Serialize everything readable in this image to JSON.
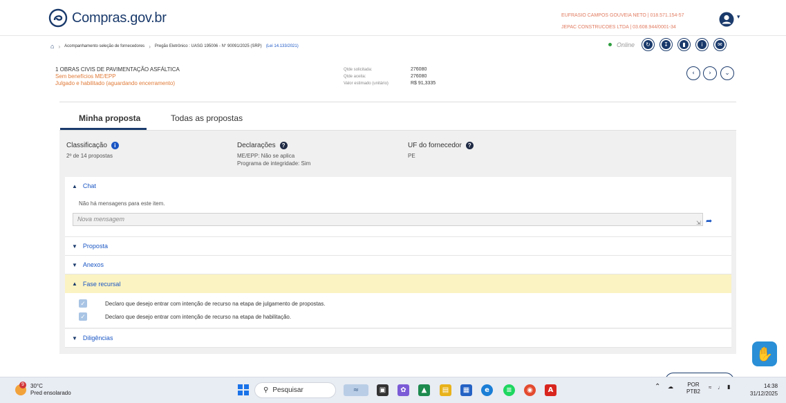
{
  "header": {
    "brand": "Compras.gov.br",
    "user_line1": "EUFRASIO CAMPOS GOUVEIA NETO | 018.571.154-57",
    "user_line2": "JEPAC CONSTRUCOES LTDA | 03.608.944/0001-34"
  },
  "breadcrumb": {
    "item1": "Acompanhamento seleção de fornecedores",
    "item2": "Pregão Eletrônico : UASG 195006 - N° 90091/2025 (SRP)",
    "item2_link": "(Lei 14.133/2021)"
  },
  "status": {
    "online": "Online"
  },
  "item": {
    "title": "1  OBRAS CIVIS DE PAVIMENTAÇÃO ASFÁLTICA",
    "benefit": "Sem benefícios ME/EPP",
    "situation": "Julgado e habilitado (aguardando encerramento)",
    "qty_requested_label": "Qtde solicitada:",
    "qty_accepted_label": "Qtde aceita:",
    "estimated_value_label": "Valor estimado (unitário)",
    "qty_requested": "276080",
    "qty_accepted": "276080",
    "estimated_value": "R$ 91,3335"
  },
  "tabs": {
    "my_proposal": "Minha proposta",
    "all_proposals": "Todas as propostas"
  },
  "classification": {
    "label": "Classificação",
    "value": "2º de 14 propostas"
  },
  "declarations": {
    "label": "Declarações",
    "me_epp": "ME/EPP: Não se aplica",
    "integrity": "Programa de integridade: Sim"
  },
  "uf": {
    "label": "UF do fornecedor",
    "value": "PE"
  },
  "chat": {
    "label": "Chat",
    "no_messages": "Não há mensagens para este item.",
    "placeholder": "Nova mensagem"
  },
  "sections": {
    "proposal": "Proposta",
    "attachments": "Anexos",
    "appeal_phase": "Fase recursal",
    "diligences": "Diligências"
  },
  "appeal": {
    "decl1": "Declaro que desejo entrar com intenção de recurso na etapa de julgamento de propostas.",
    "decl2": "Declaro que desejo entrar com intenção de recurso na etapa de habilitação."
  },
  "taskbar": {
    "weather_temp": "30°C",
    "weather_desc": "Pred ensolarado",
    "weather_badge": "9",
    "search": "Pesquisar",
    "lang1": "POR",
    "lang2": "PTB2",
    "time": "14:38",
    "date": "31/12/2025"
  },
  "colors": {
    "brand_navy": "#1a3a6b",
    "link_blue": "#1a56c4",
    "orange": "#e07a37",
    "appeal_bg": "#fbf3c2",
    "panel_bg": "#f0f0f0"
  }
}
